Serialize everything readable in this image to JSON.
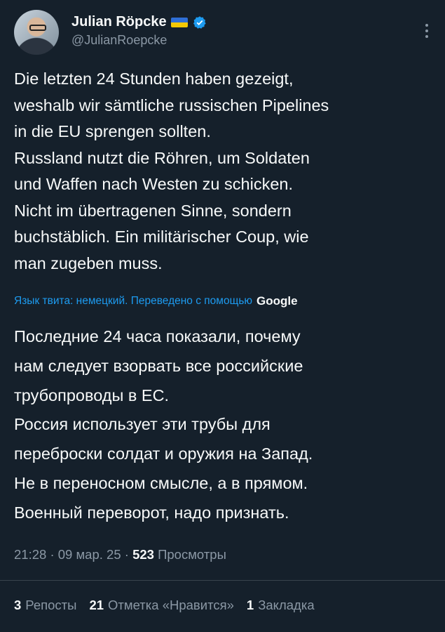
{
  "author": {
    "display_name": "Julian Röpcke",
    "handle": "@JulianRoepcke",
    "flag_icon": "ukraine-flag-icon",
    "verified_icon": "verified-badge-icon",
    "verified_color": "#1d9bf0"
  },
  "tweet": {
    "original_text": "Die letzten 24 Stunden haben gezeigt,\nweshalb wir sämtliche russischen Pipelines\nin die EU sprengen sollten.\nRussland nutzt die Röhren, um Soldaten\nund Waffen nach Westen zu schicken.\nNicht im übertragenen Sinne, sondern\nbuchstäblich. Ein militärischer Coup, wie\nman zugeben muss.",
    "translation_note": "Язык твита: немецкий. Переведено с помощью",
    "translation_provider": "Google",
    "translated_text": "Последние 24 часа показали, почему\nнам следует взорвать все российские\nтрубопроводы в ЕС.\nРоссия использует эти трубы для\nпереброски солдат и оружия на Запад.\nНе в переносном смысле, а в прямом.\nВоенный переворот, надо признать."
  },
  "meta": {
    "time": "21:28",
    "date": "09 мар. 25",
    "views_count": "523",
    "views_label": "Просмотры"
  },
  "stats": {
    "reposts_count": "3",
    "reposts_label": "Репосты",
    "likes_count": "21",
    "likes_label": "Отметка «Нравится»",
    "bookmarks_count": "1",
    "bookmarks_label": "Закладка"
  },
  "colors": {
    "background": "#15202b",
    "text": "#f7f9f9",
    "secondary": "#8b98a5",
    "accent": "#1d9bf0"
  }
}
